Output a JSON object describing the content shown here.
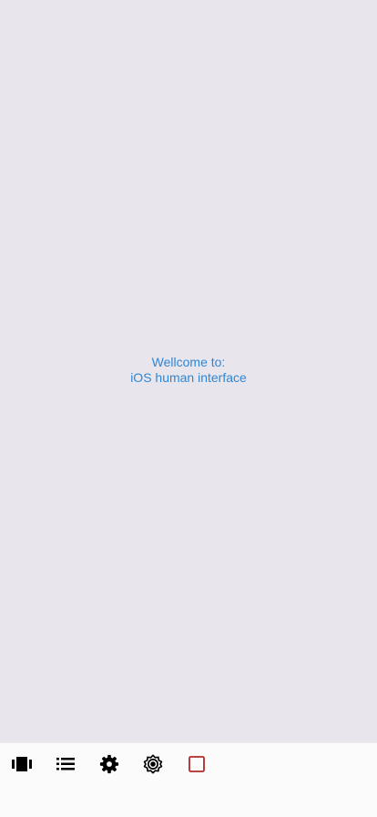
{
  "welcome": {
    "line1": "Wellcome to:",
    "line2": "iOS human interface",
    "color": "#2f86d6"
  },
  "tabbar": {
    "items": [
      {
        "icon": "carousel-icon"
      },
      {
        "icon": "list-icon"
      },
      {
        "icon": "settings-filled-icon"
      },
      {
        "icon": "settings-outline-icon"
      },
      {
        "icon": "stop-square-icon",
        "color": "#b02a2a"
      }
    ]
  }
}
